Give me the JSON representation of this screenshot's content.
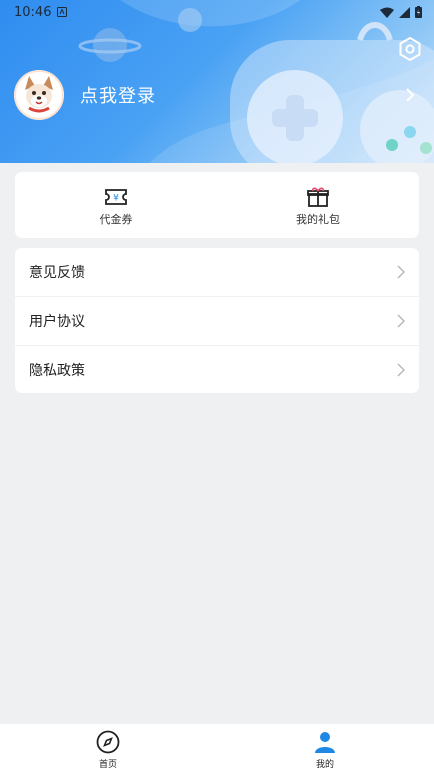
{
  "status_bar": {
    "time": "10:46"
  },
  "profile": {
    "login_label": "点我登录",
    "accent_color": "#2f8cf0"
  },
  "quick_actions": [
    {
      "label": "代金券",
      "icon": "coupon-icon"
    },
    {
      "label": "我的礼包",
      "icon": "gift-icon"
    }
  ],
  "menu": [
    {
      "label": "意见反馈"
    },
    {
      "label": "用户协议"
    },
    {
      "label": "隐私政策"
    }
  ],
  "tabbar": [
    {
      "label": "首页",
      "icon": "compass-icon"
    },
    {
      "label": "我的",
      "icon": "user-icon",
      "active": true,
      "active_color": "#1e88e5"
    }
  ]
}
